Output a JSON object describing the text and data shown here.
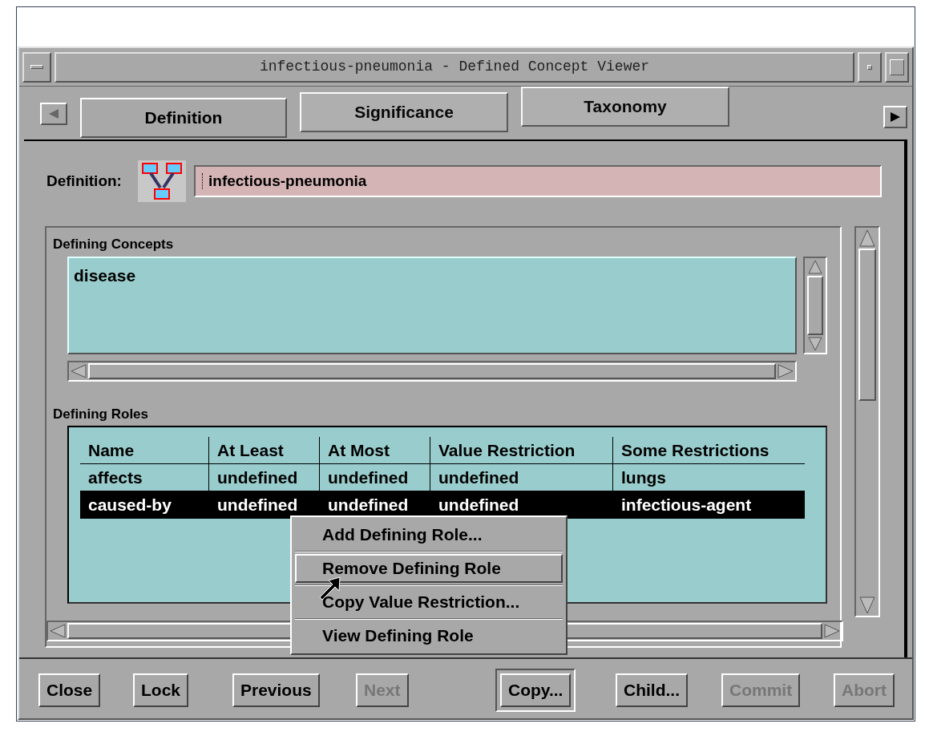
{
  "window": {
    "title": "infectious-pneumonia - Defined Concept Viewer"
  },
  "tabs": [
    {
      "label": "Definition",
      "selected": true
    },
    {
      "label": "Significance",
      "selected": false
    },
    {
      "label": "Taxonomy",
      "selected": false
    }
  ],
  "definition": {
    "label": "Definition:",
    "value": "infectious-pneumonia"
  },
  "defining_concepts": {
    "heading": "Defining Concepts",
    "items": [
      "disease"
    ]
  },
  "defining_roles": {
    "heading": "Defining Roles",
    "columns": [
      "Name",
      "At Least",
      "At Most",
      "Value Restriction",
      "Some Restrictions"
    ],
    "rows": [
      {
        "cells": [
          "affects",
          "undefined",
          "undefined",
          "undefined",
          "lungs"
        ],
        "selected": false
      },
      {
        "cells": [
          "caused-by",
          "undefined",
          "undefined",
          "undefined",
          "infectious-agent"
        ],
        "selected": true
      }
    ]
  },
  "context_menu": [
    {
      "label": "Add Defining Role...",
      "selected": false
    },
    {
      "label": "Remove Defining Role",
      "selected": true
    },
    {
      "label": "Copy Value Restriction...",
      "selected": false
    },
    {
      "label": "View Defining Role",
      "selected": false
    }
  ],
  "buttons": [
    {
      "label": "Close",
      "disabled": false,
      "default": false
    },
    {
      "label": "Lock",
      "disabled": false,
      "default": false
    },
    {
      "label": "Previous",
      "disabled": false,
      "default": false
    },
    {
      "label": "Next",
      "disabled": true,
      "default": false
    },
    {
      "label": "Copy...",
      "disabled": false,
      "default": true
    },
    {
      "label": "Child...",
      "disabled": false,
      "default": false
    },
    {
      "label": "Commit",
      "disabled": true,
      "default": false
    },
    {
      "label": "Abort",
      "disabled": true,
      "default": false
    }
  ]
}
